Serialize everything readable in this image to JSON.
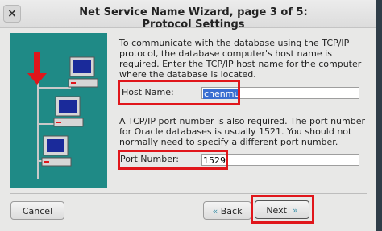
{
  "window": {
    "close_glyph": "×",
    "title": "Net Service Name Wizard, page 3 of 5: Protocol Settings"
  },
  "intro_text": "To communicate with the database using the TCP/IP protocol, the database computer's host name is required.  Enter the TCP/IP host name for the computer where the database is located.",
  "host": {
    "label": "Host Name:",
    "value": "chenmu"
  },
  "port_text": "A TCP/IP port number is also required.  The port number for Oracle databases is usually 1521.  You should not normally need to specify a different port number.",
  "port": {
    "label": "Port Number:",
    "value": "1529"
  },
  "buttons": {
    "cancel": "Cancel",
    "back": "Back",
    "next": "Next"
  },
  "glyphs": {
    "back_chevron": "«",
    "next_chevron": "»"
  },
  "colors": {
    "highlight": "#e0161b",
    "art_bg": "#1f8a86",
    "arrow": "#e0161b",
    "selection": "#3b6fd1"
  }
}
